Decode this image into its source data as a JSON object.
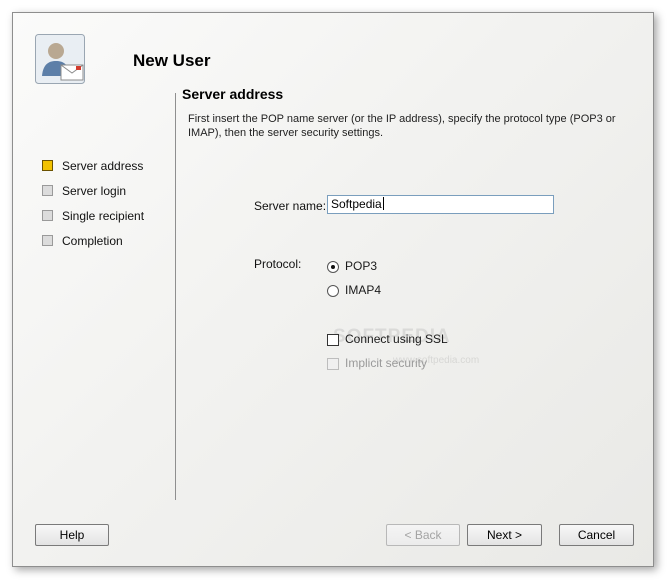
{
  "header": {
    "title": "New User",
    "icon": "user-mail-icon"
  },
  "section": {
    "title": "Server address",
    "description": "First insert the POP name server (or the IP address), specify the protocol type (POP3 or IMAP), then the server security settings."
  },
  "steps": [
    {
      "label": "Server address",
      "active": true
    },
    {
      "label": "Server login",
      "active": false
    },
    {
      "label": "Single recipient",
      "active": false
    },
    {
      "label": "Completion",
      "active": false
    }
  ],
  "form": {
    "server_name_label": "Server name:",
    "server_name_value": "Softpedia",
    "protocol_label": "Protocol:",
    "protocol_options": [
      {
        "label": "POP3",
        "selected": true
      },
      {
        "label": "IMAP4",
        "selected": false
      }
    ],
    "ssl_label": "Connect using SSL",
    "ssl_checked": false,
    "implicit_label": "Implicit security",
    "implicit_enabled": false
  },
  "watermark": {
    "text": "SOFTPEDIA",
    "url": "www.softpedia.com"
  },
  "buttons": {
    "help": "Help",
    "back": "< Back",
    "next": "Next >",
    "cancel": "Cancel"
  },
  "colors": {
    "active_step": "#f2c200",
    "inactive_step": "#dcdcdc",
    "input_border": "#7a9ebd"
  }
}
